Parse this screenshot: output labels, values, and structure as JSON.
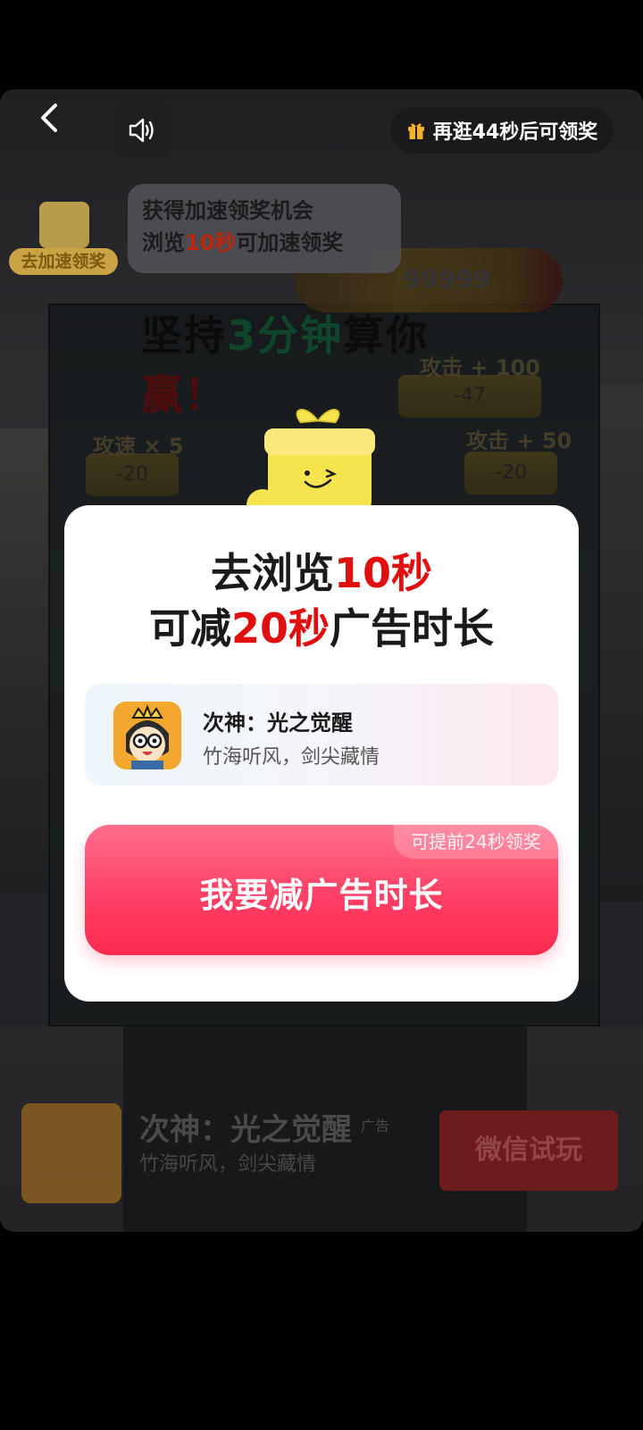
{
  "top_bar": {
    "back_icon": "chevron-left-icon",
    "sound_icon": "speaker-icon",
    "reward_text": "再逛44秒后可领奖"
  },
  "speed_badge": {
    "label": "去加速领奖"
  },
  "tip_bubble": {
    "line1": "获得加速领奖机会",
    "line2_prefix": "浏览",
    "line2_highlight": "10秒",
    "line2_suffix": "可加速领奖"
  },
  "background_game": {
    "title_part1": "坚持",
    "title_part2": "3分钟",
    "title_part3": "算你",
    "title_part4": "赢！",
    "score": "99999",
    "gate_left_label": "攻速 × 5",
    "gate_left_value": "-20",
    "gate_mid_label": "攻击 + 100",
    "gate_mid_value": "-47",
    "gate_right_label": "攻击 + 50",
    "gate_right_value": "-20"
  },
  "modal": {
    "line1_prefix": "去浏览",
    "line1_highlight": "10秒",
    "line2_prefix": "可减",
    "line2_highlight": "20秒",
    "line2_suffix": "广告时长",
    "app_name": "次神：光之觉醒",
    "app_desc": "竹海听风，剑尖藏情",
    "cta_label": "我要减广告时长",
    "cta_badge": "可提前24秒领奖"
  },
  "bottom_bar": {
    "app_name": "次神：光之觉醒",
    "ad_tag": "广告",
    "app_desc": "竹海听风，剑尖藏情",
    "button_label": "微信试玩"
  },
  "colors": {
    "accent_red": "#e01010",
    "cta_pink": "#ff3f64",
    "modal_bg": "#ffffff"
  }
}
